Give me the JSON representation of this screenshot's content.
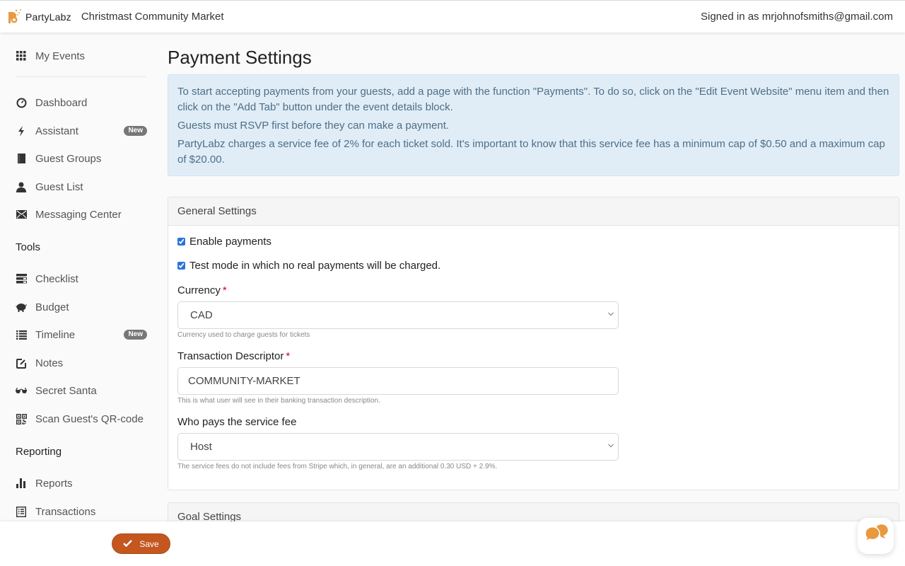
{
  "header": {
    "brand_name": "PartyLabz",
    "event_title": "Christmast Community Market",
    "signed_in_text": "Signed in as mrjohnofsmiths@gmail.com"
  },
  "sidebar": {
    "my_events": {
      "label": "My Events",
      "icon": "grid-icon"
    },
    "items": [
      {
        "label": "Dashboard",
        "icon": "dashboard-icon"
      },
      {
        "label": "Assistant",
        "icon": "lightning-icon",
        "badge": "New"
      },
      {
        "label": "Guest Groups",
        "icon": "book-icon"
      },
      {
        "label": "Guest List",
        "icon": "user-icon"
      },
      {
        "label": "Messaging Center",
        "icon": "envelope-icon"
      }
    ],
    "tools_heading": "Tools",
    "tools": [
      {
        "label": "Checklist",
        "icon": "checklist-icon"
      },
      {
        "label": "Budget",
        "icon": "piggy-bank-icon"
      },
      {
        "label": "Timeline",
        "icon": "list-icon",
        "badge": "New"
      },
      {
        "label": "Notes",
        "icon": "edit-icon"
      },
      {
        "label": "Secret Santa",
        "icon": "sunglasses-icon"
      },
      {
        "label": "Scan Guest's QR-code",
        "icon": "qr-code-icon"
      }
    ],
    "reporting_heading": "Reporting",
    "reporting": [
      {
        "label": "Reports",
        "icon": "bar-chart-icon"
      },
      {
        "label": "Transactions",
        "icon": "receipt-icon"
      }
    ]
  },
  "main": {
    "page_title": "Payment Settings",
    "alert": {
      "p1": "To start accepting payments from your guests, add a page with the function \"Payments\". To do so, click on the \"Edit Event Website\" menu item and then click on the \"Add Tab\" button under the event details block.",
      "p2": "Guests must RSVP first before they can make a payment.",
      "p3": "PartyLabz charges a service fee of 2% for each ticket sold. It's important to know that this service fee has a minimum cap of $0.50 and a maximum cap of $20.00."
    },
    "general_settings": {
      "heading": "General Settings",
      "enable_payments": {
        "label": "Enable payments",
        "checked": true
      },
      "test_mode": {
        "label": "Test mode in which no real payments will be charged.",
        "checked": true
      },
      "currency": {
        "label": "Currency",
        "required_mark": "*",
        "value": "CAD",
        "help": "Currency used to charge guests for tickets"
      },
      "descriptor": {
        "label": "Transaction Descriptor",
        "required_mark": "*",
        "value": "COMMUNITY-MARKET",
        "help": "This is what user will see in their banking transaction description."
      },
      "fee_payer": {
        "label": "Who pays the service fee",
        "value": "Host",
        "help": "The service fees do not include fees from Stripe which, in general, are an additional 0.30 USD + 2.9%."
      }
    },
    "goal_settings": {
      "heading": "Goal Settings"
    }
  },
  "footer": {
    "save_label": "Save"
  },
  "colors": {
    "accent": "#c4561f",
    "brand_orange": "#e8993f",
    "alert_bg": "#e0edf7",
    "alert_text": "#4f6e86"
  }
}
